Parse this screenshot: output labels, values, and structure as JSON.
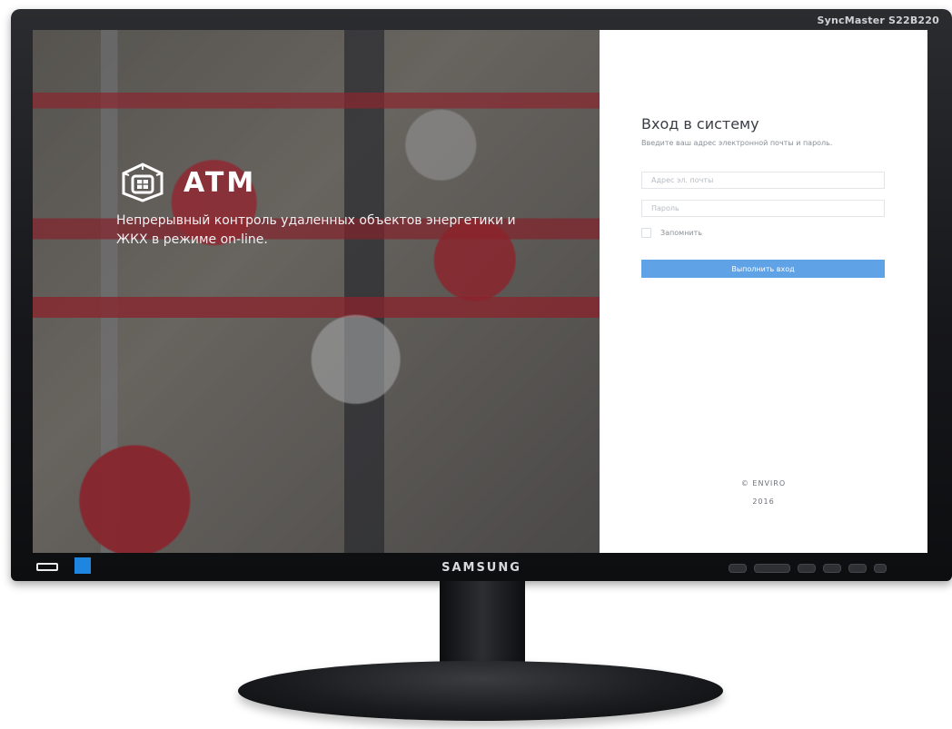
{
  "monitor": {
    "model_label": "SyncMaster S22B220",
    "brand": "SAMSUNG",
    "led_indicator_color": "#1f86e0"
  },
  "hero": {
    "logo_icon": "building-grid-icon",
    "brand_name": "ATM",
    "tagline": "Непрерывный контроль удаленных объектов энергетики и ЖКХ в режиме on-line."
  },
  "login": {
    "title": "Вход в систему",
    "subtitle": "Введите ваш адрес электронной почты и пароль.",
    "email_placeholder": "Адрес эл. почты",
    "email_value": "",
    "password_placeholder": "Пароль",
    "password_value": "",
    "remember_label": "Запомнить",
    "remember_checked": false,
    "submit_label": "Выполнить вход",
    "accent_color": "#5fa2e6"
  },
  "footer": {
    "copyright": "© ENVIRO",
    "year": "2016"
  }
}
